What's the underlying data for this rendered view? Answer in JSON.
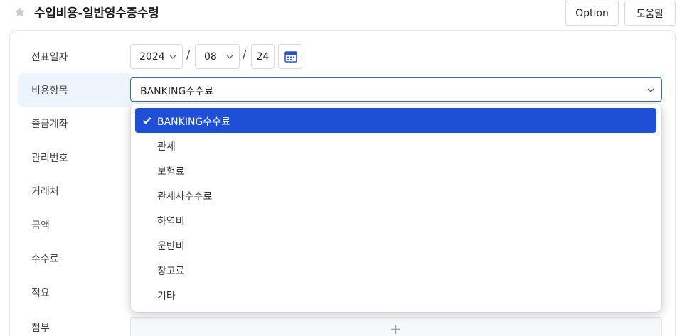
{
  "header": {
    "title": "수입비용-일반영수증수령",
    "option_label": "Option",
    "help_label": "도움말"
  },
  "form": {
    "date_label": "전표일자",
    "year": "2024",
    "month": "08",
    "day": "24",
    "date_separator": "/",
    "expense_item_label": "비용항목",
    "expense_item_value": "BANKING수수료",
    "withdrawal_account_label": "출금계좌",
    "management_no_label": "관리번호",
    "vendor_label": "거래처",
    "amount_label": "금액",
    "fee_label": "수수료",
    "memo_label": "적요",
    "attachment_label": "첨부",
    "attachment_add": "+"
  },
  "dropdown": {
    "options": [
      {
        "label": "BANKING수수료",
        "selected": true
      },
      {
        "label": "관세",
        "selected": false
      },
      {
        "label": "보험료",
        "selected": false
      },
      {
        "label": "관세사수수료",
        "selected": false
      },
      {
        "label": "하역비",
        "selected": false
      },
      {
        "label": "운반비",
        "selected": false
      },
      {
        "label": "창고료",
        "selected": false
      },
      {
        "label": "기타",
        "selected": false
      }
    ]
  },
  "colors": {
    "accent": "#1f4fd4",
    "focus_border": "#2f6fb5",
    "row_highlight": "#eef4fb",
    "calendar_icon": "#2b55c8"
  },
  "icons": {
    "favorite": "star-icon",
    "calendar": "calendar-icon",
    "dropdown": "chevron-down-icon",
    "selected": "check-icon"
  }
}
